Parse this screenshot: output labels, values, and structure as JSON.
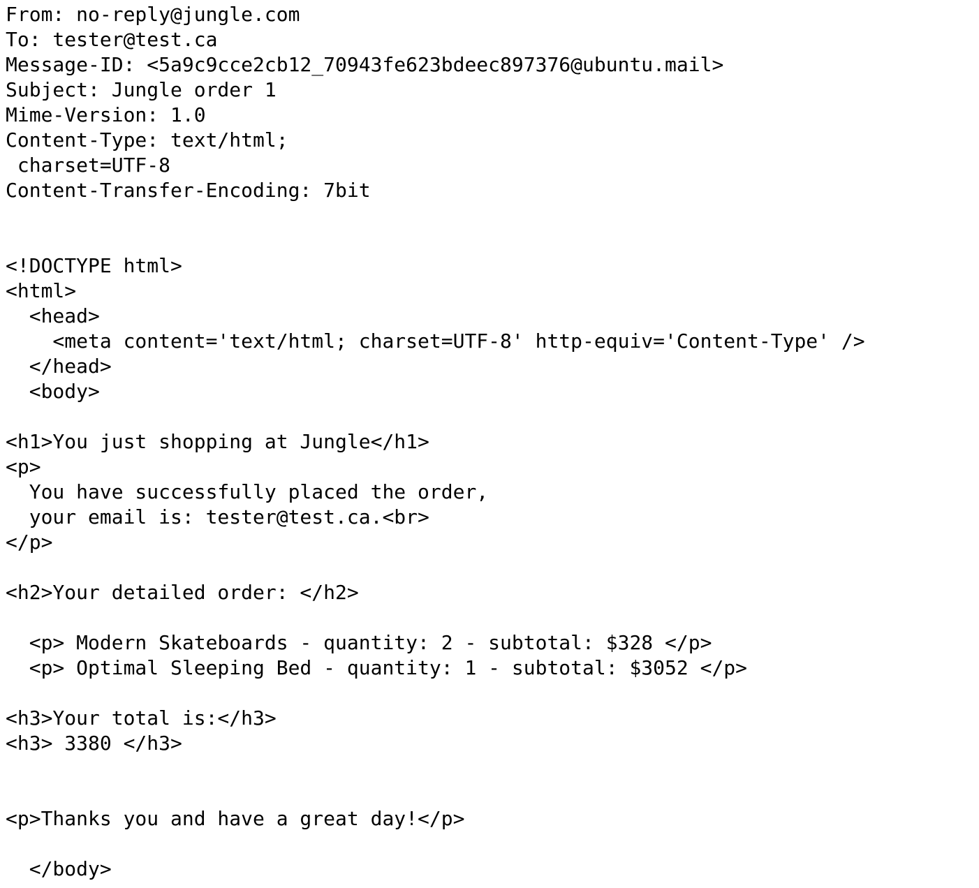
{
  "email": {
    "lines": [
      "From: no-reply@jungle.com",
      "To: tester@test.ca",
      "Message-ID: <5a9c9cce2cb12_70943fe623bdeec897376@ubuntu.mail>",
      "Subject: Jungle order 1",
      "Mime-Version: 1.0",
      "Content-Type: text/html;",
      " charset=UTF-8",
      "Content-Transfer-Encoding: 7bit",
      "",
      "",
      "<!DOCTYPE html>",
      "<html>",
      "  <head>",
      "    <meta content='text/html; charset=UTF-8' http-equiv='Content-Type' />",
      "  </head>",
      "  <body>",
      "",
      "<h1>You just shopping at Jungle</h1>",
      "<p>",
      "  You have successfully placed the order,",
      "  your email is: tester@test.ca.<br>",
      "</p>",
      "",
      "<h2>Your detailed order: </h2>",
      "",
      "  <p> Modern Skateboards - quantity: 2 - subtotal: $328 </p>",
      "  <p> Optimal Sleeping Bed - quantity: 1 - subtotal: $3052 </p>",
      "",
      "<h3>Your total is:</h3>",
      "<h3> 3380 </h3>",
      "",
      "",
      "<p>Thanks you and have a great day!</p>",
      "",
      "  </body>"
    ]
  }
}
